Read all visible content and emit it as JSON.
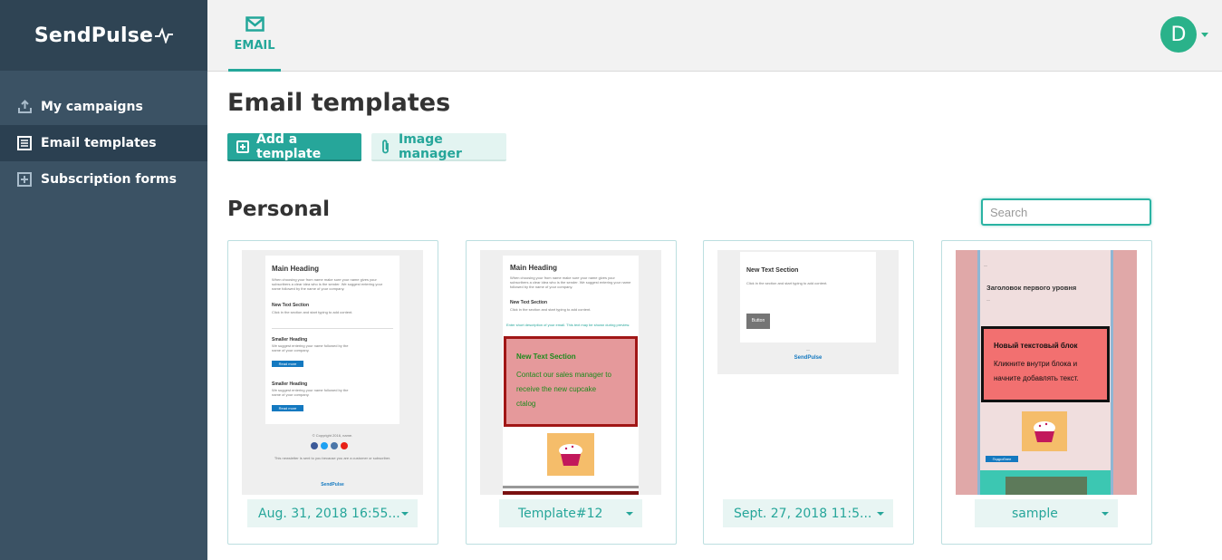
{
  "brand": {
    "name": "SendPulse",
    "accent": "#26a69a"
  },
  "sidebar": {
    "items": [
      {
        "label": "My campaigns",
        "icon": "upload-icon",
        "active": false
      },
      {
        "label": "Email templates",
        "icon": "templates-icon",
        "active": true
      },
      {
        "label": "Subscription forms",
        "icon": "form-plus-icon",
        "active": false
      }
    ]
  },
  "topbar": {
    "tabs": [
      {
        "label": "EMAIL",
        "icon": "envelope-icon",
        "active": true
      }
    ],
    "user_initial": "D"
  },
  "main": {
    "title": "Email templates",
    "add_template_label": "Add a template",
    "image_manager_label": "Image manager",
    "section_title": "Personal",
    "search_placeholder": "Search"
  },
  "cards": [
    {
      "label": "Aug. 31, 2018 16:55...",
      "thumb": {
        "heading": "Main Heading",
        "text_section": "New Text Section",
        "smaller_1": "Smaller Heading",
        "smaller_2": "Smaller Heading",
        "button": "Read more",
        "footer_brand": "SendPulse"
      }
    },
    {
      "label": "Template#12",
      "thumb": {
        "heading": "Main Heading",
        "text_section": "New Text Section",
        "highlight_title": "New Text Section",
        "highlight_line1": "Contact our sales manager to",
        "highlight_line2": "receive the new cupcake",
        "highlight_line3": "ctalog"
      }
    },
    {
      "label": "Sept. 27, 2018 11:5...",
      "thumb": {
        "heading": "New Text Section",
        "body": "Click in the section and start typing to add content.",
        "button": "Button",
        "footer_brand": "SendPulse"
      }
    },
    {
      "label": "sample",
      "thumb": {
        "heading": "Заголовок первого уровня",
        "box_title": "Новый текстовый блок",
        "box_line1": "Кликните внутри блока и",
        "box_line2": "начните добавлять текст.",
        "button": "Подробнее"
      }
    }
  ]
}
